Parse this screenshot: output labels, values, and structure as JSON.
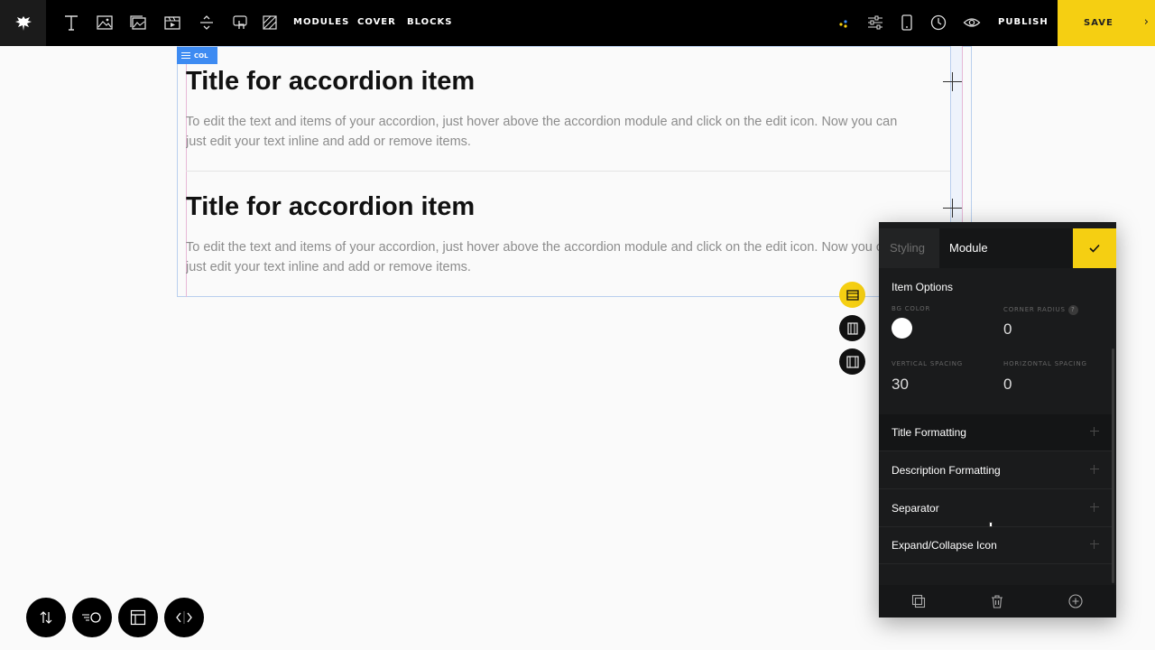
{
  "topbar": {
    "tools": [
      "text-icon",
      "image-icon",
      "gallery-icon",
      "video-icon",
      "divider-icon",
      "interaction-icon",
      "pattern-icon"
    ],
    "nav": [
      "MODULES",
      "COVER",
      "BLOCKS"
    ],
    "right_icons": [
      "dots-icon",
      "sliders-icon",
      "mobile-icon",
      "clock-icon",
      "eye-icon"
    ],
    "publish": "PUBLISH",
    "save": "SAVE",
    "save_chevron": "›"
  },
  "canvas": {
    "col_tag": "COL",
    "items": [
      {
        "title": "Title for accordion item",
        "description_line1": "To edit the text and items of your accordion, just hover above the accordion module and click on the edit icon. Now you can",
        "description_line2": "just edit your text inline and add or remove items."
      },
      {
        "title": "Title for accordion item",
        "description_line1": "To edit the text and items of your accordion, just hover above the accordion module and click on the edit icon. Now you can",
        "description_line2": "just edit your text inline and add or remove items."
      }
    ]
  },
  "panel": {
    "tab_styling": "Styling",
    "tab_module": "Module",
    "section_title": "Item Options",
    "bg_color_label": "BG COLOR",
    "bg_color_value": "#ffffff",
    "corner_radius_label": "CORNER RADIUS",
    "corner_radius_help": "?",
    "corner_radius_value": "0",
    "vertical_spacing_label": "VERTICAL SPACING",
    "vertical_spacing_value": "30",
    "horizontal_spacing_label": "HORIZONTAL SPACING",
    "horizontal_spacing_value": "0",
    "rows": [
      "Title Formatting",
      "Description Formatting",
      "Separator",
      "Expand/Collapse Icon"
    ]
  },
  "colors": {
    "accent": "#f5cf12",
    "selection": "#3d8bf2",
    "topbar": "#000000",
    "panel": "#1a1b1c"
  }
}
